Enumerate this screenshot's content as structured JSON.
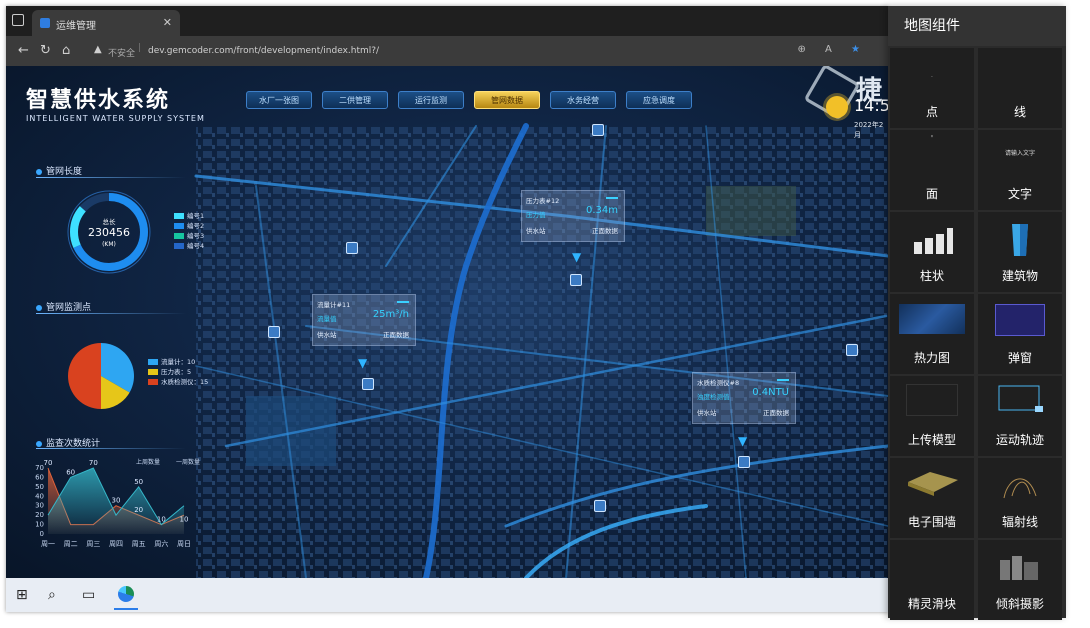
{
  "browser": {
    "tab_title": "运维管理",
    "security_label": "不安全",
    "url": "dev.gemcoder.com/front/development/index.html?/"
  },
  "app": {
    "title_cn": "智慧供水系统",
    "title_en": "INTELLIGENT WATER SUPPLY SYSTEM",
    "nav_tabs": [
      {
        "label": "水厂一张图",
        "active": false
      },
      {
        "label": "二供管理",
        "active": false
      },
      {
        "label": "运行监测",
        "active": false
      },
      {
        "label": "管网数据",
        "active": true
      },
      {
        "label": "水务经营",
        "active": false
      },
      {
        "label": "应急调度",
        "active": false
      }
    ],
    "brand": "捷",
    "clock": "14:5",
    "date": "2022年2月",
    "sections": {
      "pipe_length": "管网长度",
      "pipe_monitor": "管网监测点",
      "stats": "监查次数统计"
    },
    "donut": {
      "label": "总长",
      "value": "230456",
      "unit": "(KM)",
      "legend": [
        "编号1",
        "编号2",
        "编号3",
        "编号4"
      ]
    },
    "pie_legend": [
      {
        "label": "流量计：10",
        "color": "#2ea6f2"
      },
      {
        "label": "压力表：5",
        "color": "#e6c619"
      },
      {
        "label": "水质检测仪：15",
        "color": "#d9421f"
      }
    ],
    "popups": [
      {
        "title": "压力表#12",
        "l1": "压力值",
        "v1": "0.34m",
        "l2": "供水站",
        "v2": "正面数据"
      },
      {
        "title": "流量计#11",
        "l1": "流量值",
        "v1": "25m³/h",
        "l2": "供水站",
        "v2": "正面数据"
      },
      {
        "title": "水质检测仪#8",
        "l1": "浊度检测值",
        "v1": "0.4NTU",
        "l2": "供水站",
        "v2": "正面数据"
      }
    ]
  },
  "chart_data": [
    {
      "type": "pie",
      "title": "",
      "labels": [
        "流量计",
        "压力表",
        "水质检测仪"
      ],
      "values": [
        10,
        5,
        15
      ],
      "colors": [
        "#2ea6f2",
        "#e6c619",
        "#d9421f"
      ]
    },
    {
      "type": "area",
      "title": "",
      "categories": [
        "周一",
        "周二",
        "周三",
        "周四",
        "周五",
        "周六",
        "周日"
      ],
      "ylim": [
        0,
        70
      ],
      "yticks": [
        0,
        10,
        20,
        30,
        40,
        50,
        60,
        70
      ],
      "legend": [
        "上周数量",
        "一周数量"
      ],
      "series": [
        {
          "values": [
            70,
            10,
            10,
            30,
            20,
            10,
            20
          ],
          "color": "#e0623a"
        },
        {
          "values": [
            20,
            60,
            70,
            20,
            50,
            10,
            30
          ],
          "color": "#35b7c9"
        }
      ],
      "data_labels": [
        {
          "x": "周一",
          "text": "70"
        },
        {
          "x": "周二",
          "text": "60"
        },
        {
          "x": "周三",
          "text": "70"
        },
        {
          "x": "周四",
          "text": "30"
        },
        {
          "x": "周五",
          "text": "50"
        },
        {
          "x": "周五",
          "text": "20"
        },
        {
          "x": "周六",
          "text": "10"
        },
        {
          "x": "周日",
          "text": "10"
        }
      ]
    }
  ],
  "taskbar": {
    "icons": [
      "windows-icon",
      "search-icon",
      "task-view-icon",
      "edge-icon"
    ]
  },
  "panel": {
    "title": "地图组件",
    "items": [
      "点",
      "线",
      "面",
      "文字",
      "柱状",
      "建筑物",
      "热力图",
      "弹窗",
      "上传模型",
      "运动轨迹",
      "电子围墙",
      "辐射线",
      "精灵滑块",
      "倾斜摄影"
    ],
    "text_preview": "请输入文字"
  },
  "colors": {
    "accent": "#39a7ff",
    "panel_bg": "#2b2b2b",
    "active_tab": "#f6d25a"
  }
}
